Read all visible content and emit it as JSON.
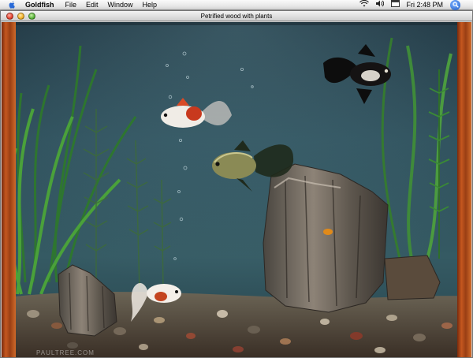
{
  "menubar": {
    "app_name": "Goldfish",
    "items": [
      "File",
      "Edit",
      "Window",
      "Help"
    ],
    "clock": "Fri 2:48 PM"
  },
  "window": {
    "title": "Petrified wood with plants"
  },
  "scene": {
    "watermark": "PAULTREE.COM",
    "colors": {
      "water_top": "#172a36",
      "water_mid": "#355a63",
      "wood_frame": "#b84e1c"
    }
  },
  "icons": [
    "apple-icon",
    "wifi-icon",
    "volume-icon",
    "calendar-icon",
    "spotlight-icon"
  ]
}
